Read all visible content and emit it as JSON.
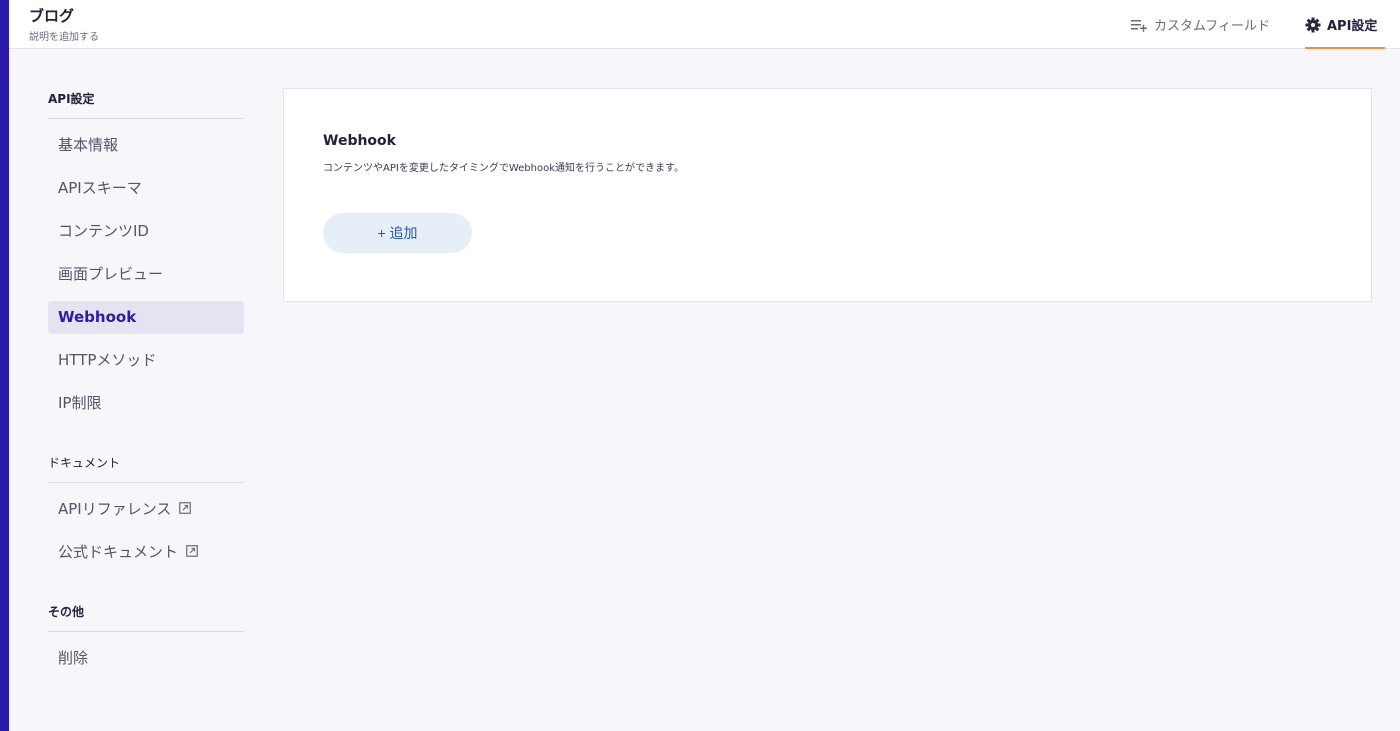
{
  "header": {
    "title": "ブログ",
    "description": "説明を追加する",
    "tabs": [
      {
        "label": "カスタムフィールド",
        "icon": "list-add-icon"
      },
      {
        "label": "API設定",
        "icon": "gear-icon"
      }
    ],
    "active_tab_color": "#f48b42"
  },
  "sidebar": {
    "sections": [
      {
        "title": "API設定",
        "items": [
          "基本情報",
          "APIスキーマ",
          "コンテンツID",
          "画面プレビュー",
          "Webhook",
          "HTTPメソッド",
          "IP制限"
        ]
      },
      {
        "title": "ドキュメント",
        "items": [
          "APIリファレンス",
          "公式ドキュメント"
        ]
      },
      {
        "title": "その他",
        "items": [
          "削除"
        ]
      }
    ],
    "active_item": "Webhook"
  },
  "main": {
    "title": "Webhook",
    "description": "コンテンツやAPIを変更したタイミングでWebhook通知を行うことができます。",
    "add_button": "+ 追加"
  },
  "colors": {
    "brand": "#2c1aa8",
    "accent": "#f48b42",
    "button_bg": "#e6eef8"
  }
}
